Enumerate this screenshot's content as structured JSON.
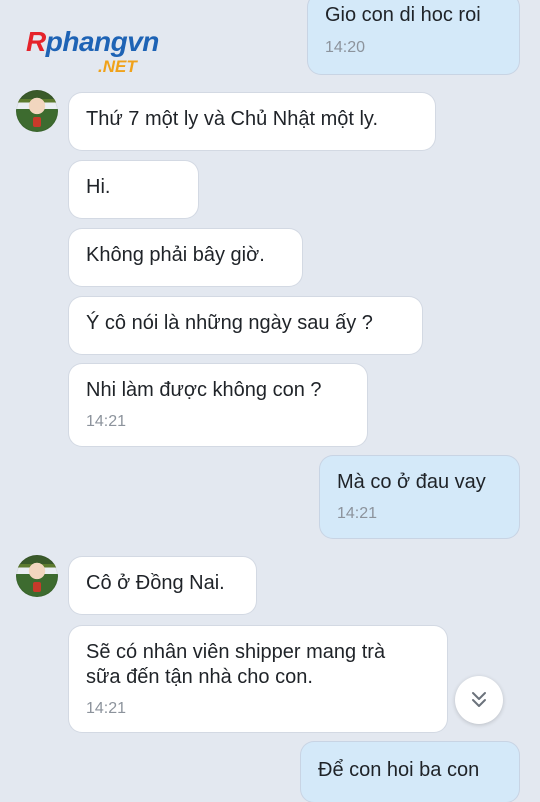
{
  "watermark": {
    "logo_r": "R",
    "logo_main": "phangvn",
    "logo_sub": ".NET"
  },
  "messages": [
    {
      "dir": "out",
      "text": "Gio con di hoc roi",
      "time": "14:20"
    },
    {
      "dir": "in",
      "text": "Thứ 7 một ly và Chủ Nhật một ly.",
      "time": ""
    },
    {
      "dir": "in",
      "text": "Hi.",
      "time": ""
    },
    {
      "dir": "in",
      "text": "Không phải bây giờ.",
      "time": ""
    },
    {
      "dir": "in",
      "text": "Ý cô nói là những ngày sau ấy ?",
      "time": ""
    },
    {
      "dir": "in",
      "text": "Nhi làm được không con ?",
      "time": "14:21"
    },
    {
      "dir": "out",
      "text": "Mà co ở đau vay",
      "time": "14:21"
    },
    {
      "dir": "in",
      "text": "Cô ở Đồng Nai.",
      "time": ""
    },
    {
      "dir": "in",
      "text_line1": "Sẽ có nhân viên shipper mang trà",
      "text_line2": "sữa đến tận nhà cho con.",
      "time": "14:21"
    },
    {
      "dir": "out",
      "text": "Để con hoi ba con",
      "time": ""
    }
  ],
  "icons": {
    "avatar": "contact-avatar",
    "scroll": "chevron-double-down-icon"
  },
  "colors": {
    "background": "#e3e8f0",
    "incoming_bubble": "#ffffff",
    "outgoing_bubble": "#d4e9f9",
    "timestamp": "#8c939c"
  }
}
